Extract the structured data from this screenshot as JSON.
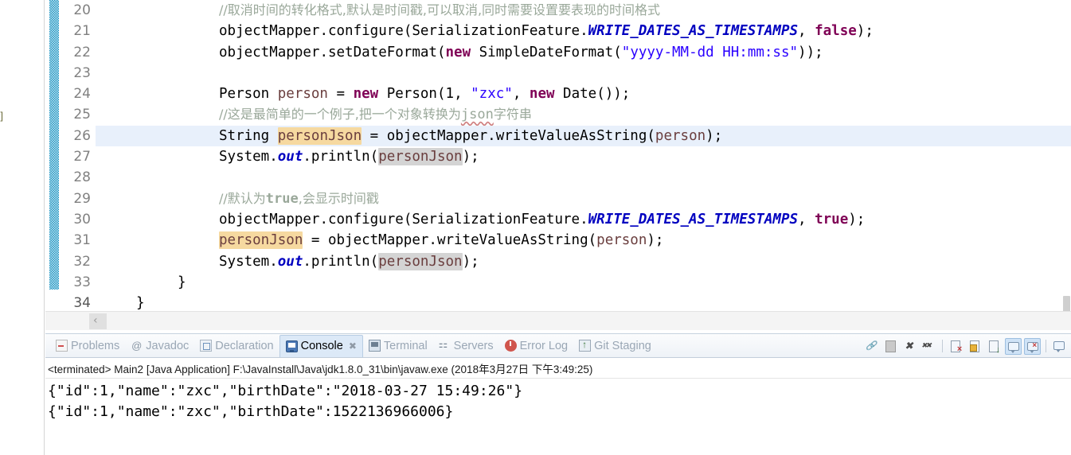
{
  "editor": {
    "first_line_number": 20,
    "highlighted_line_number": 26,
    "left_fragment": "r]",
    "scroll_left_arrow": "‹",
    "lines": [
      {
        "num": "20",
        "kind": "comment",
        "text": "//取消时间的转化格式,默认是时间戳,可以取消,同时需要设置要表现的时间格式"
      },
      {
        "num": "21",
        "kind": "code",
        "text": "objectMapper.configure(SerializationFeature.WRITE_DATES_AS_TIMESTAMPS, false);"
      },
      {
        "num": "22",
        "kind": "code",
        "text": "objectMapper.setDateFormat(new SimpleDateFormat(\"yyyy-MM-dd HH:mm:ss\"));"
      },
      {
        "num": "23",
        "kind": "blank",
        "text": ""
      },
      {
        "num": "24",
        "kind": "code",
        "text": "Person person = new Person(1, \"zxc\", new Date());"
      },
      {
        "num": "25",
        "kind": "comment",
        "text": "//这是最简单的一个例子,把一个对象转换为json字符串"
      },
      {
        "num": "26",
        "kind": "code",
        "text": "String personJson = objectMapper.writeValueAsString(person);"
      },
      {
        "num": "27",
        "kind": "code",
        "text": "System.out.println(personJson);"
      },
      {
        "num": "28",
        "kind": "blank",
        "text": ""
      },
      {
        "num": "29",
        "kind": "comment",
        "text": "//默认为true,会显示时间戳"
      },
      {
        "num": "30",
        "kind": "code",
        "text": "objectMapper.configure(SerializationFeature.WRITE_DATES_AS_TIMESTAMPS, true);"
      },
      {
        "num": "31",
        "kind": "code",
        "text": "personJson = objectMapper.writeValueAsString(person);"
      },
      {
        "num": "32",
        "kind": "code",
        "text": "System.out.println(personJson);"
      },
      {
        "num": "33",
        "kind": "code",
        "text": "}"
      },
      {
        "num": "34",
        "kind": "code",
        "text": "}"
      }
    ],
    "tokens": {
      "line20_comment": "//取消时间的转化格式,默认是时间戳,可以取消,同时需要设置要表现的时间格式",
      "line21": {
        "obj": "objectMapper",
        "dot1": ".",
        "method": "configure",
        "open": "(",
        "type": "SerializationFeature",
        "dot2": ".",
        "const": "WRITE_DATES_AS_TIMESTAMPS",
        "comma": ", ",
        "bool": "false",
        "close": ");"
      },
      "line22": {
        "obj": "objectMapper",
        "dot1": ".",
        "method": "setDateFormat",
        "open": "(",
        "kw_new": "new",
        "type": " SimpleDateFormat",
        "open2": "(",
        "str": "\"yyyy-MM-dd HH:mm:ss\"",
        "close": "));"
      },
      "line24": {
        "type": "Person",
        "var": " person",
        "eq": " = ",
        "kw_new": "new",
        "ctor": " Person",
        "open": "(",
        "num": "1",
        "comma1": ", ",
        "str": "\"zxc\"",
        "comma2": ", ",
        "kw_new2": "new",
        "date": " Date",
        "close": "());"
      },
      "line25_comment": "//这是最简单的一个例子,把一个对象转换为json字符串",
      "line25_cjk_1": "//这是最简单的一个例子,把一个对象转换为",
      "line25_json": "json",
      "line25_cjk_2": "字符串",
      "line26": {
        "type": "String",
        "var": "personJson",
        "eq": " = ",
        "obj": "objectMapper",
        "dot": ".",
        "method": "writeValueAsString",
        "open": "(",
        "arg": "person",
        "close": ");"
      },
      "line27": {
        "sys": "System",
        "dot1": ".",
        "out": "out",
        "dot2": ".",
        "println": "println",
        "open": "(",
        "arg": "personJson",
        "close": ");"
      },
      "line29_comment": "//默认为true,会显示时间戳",
      "line29_pre": "//默认为",
      "line29_true": "true",
      "line29_post": ",会显示时间戳",
      "line30": {
        "obj": "objectMapper",
        "dot1": ".",
        "method": "configure",
        "open": "(",
        "type": "SerializationFeature",
        "dot2": ".",
        "const": "WRITE_DATES_AS_TIMESTAMPS",
        "comma": ", ",
        "bool": "true",
        "close": ");"
      },
      "line31": {
        "var": "personJson",
        "eq": " = ",
        "obj": "objectMapper",
        "dot": ".",
        "method": "writeValueAsString",
        "open": "(",
        "arg": "person",
        "close": ");"
      },
      "line32": {
        "sys": "System",
        "dot1": ".",
        "out": "out",
        "dot2": ".",
        "println": "println",
        "open": "(",
        "arg": "personJson",
        "close": ");"
      },
      "line33_brace": "}",
      "line34_brace": "}"
    },
    "colors": {
      "keyword": "#7f0055",
      "string": "#2a00ff",
      "comment": "#9aa89a",
      "static_field": "#0000c0",
      "local_var": "#6a3e3e",
      "write_occurrence": "#f6d9a0",
      "read_occurrence": "#d4d4d4",
      "current_line": "#e8f0fb",
      "change_bar": "#2196c4"
    }
  },
  "bottom_panel": {
    "tabs": [
      {
        "label": "Problems",
        "icon": "problems-icon",
        "active": false,
        "closable": false
      },
      {
        "label": "Javadoc",
        "icon": "javadoc-icon",
        "active": false,
        "closable": false
      },
      {
        "label": "Declaration",
        "icon": "declaration-icon",
        "active": false,
        "closable": false
      },
      {
        "label": "Console",
        "icon": "console-icon",
        "active": true,
        "closable": true
      },
      {
        "label": "Terminal",
        "icon": "terminal-icon",
        "active": false,
        "closable": false
      },
      {
        "label": "Servers",
        "icon": "servers-icon",
        "active": false,
        "closable": false
      },
      {
        "label": "Error Log",
        "icon": "error-log-icon",
        "active": false,
        "closable": false
      },
      {
        "label": "Git Staging",
        "icon": "git-staging-icon",
        "active": false,
        "closable": false
      }
    ],
    "close_glyph": "✖",
    "toolbar": [
      {
        "name": "link-with-editor-button",
        "toggled": false
      },
      {
        "name": "clear-console-button",
        "toggled": false
      },
      {
        "name": "terminate-button",
        "toggled": false
      },
      {
        "name": "remove-all-terminated-button",
        "toggled": false
      },
      {
        "name": "remove-launch-button",
        "toggled": false
      },
      {
        "name": "pin-console-button",
        "toggled": false
      },
      {
        "name": "scroll-lock-button",
        "toggled": false
      },
      {
        "name": "display-selected-console-button",
        "toggled": true
      },
      {
        "name": "open-console-button",
        "toggled": true
      },
      {
        "name": "new-console-view-button",
        "toggled": false
      }
    ],
    "console": {
      "status_line": "<terminated> Main2 [Java Application] F:\\JavaInstall\\Java\\jdk1.8.0_31\\bin\\javaw.exe (2018年3月27日 下午3:49:25)",
      "output_lines": [
        "{\"id\":1,\"name\":\"zxc\",\"birthDate\":\"2018-03-27 15:49:26\"}",
        "{\"id\":1,\"name\":\"zxc\",\"birthDate\":1522136966006}"
      ]
    }
  }
}
